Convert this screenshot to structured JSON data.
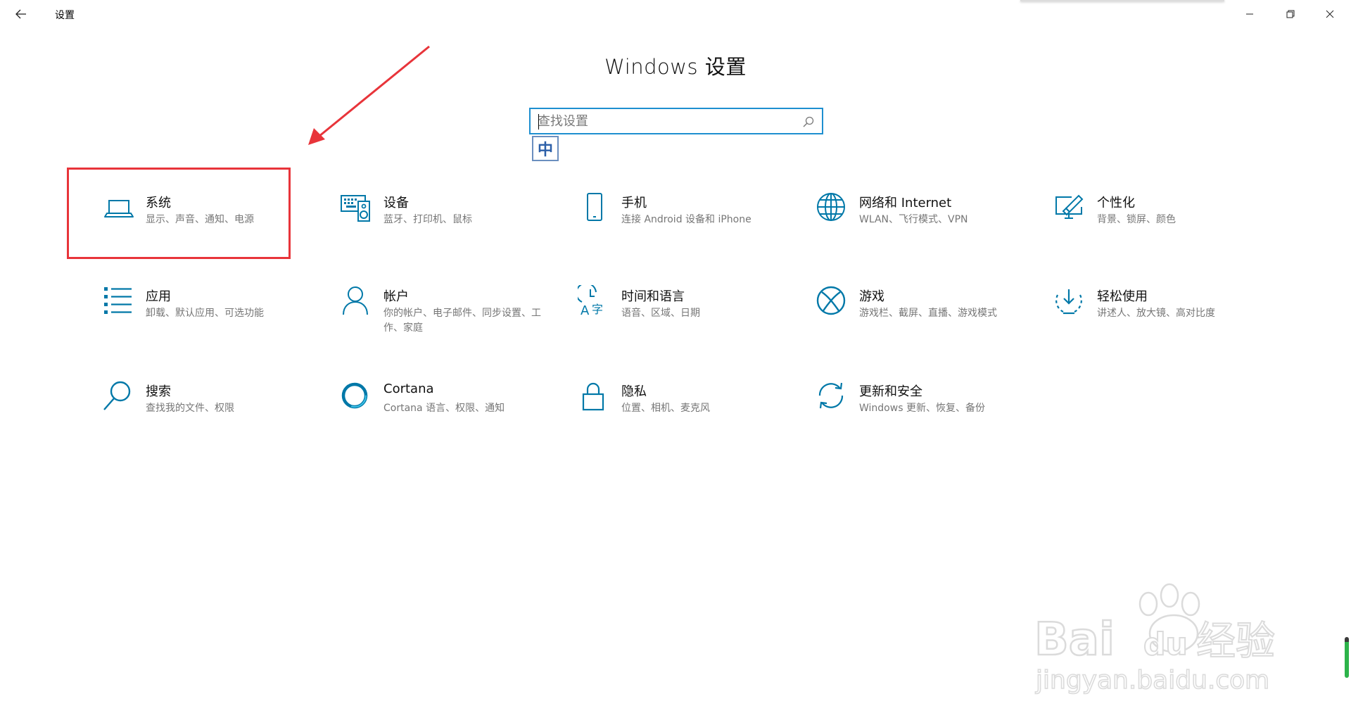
{
  "window": {
    "title": "设置",
    "back_icon": "arrow-left-icon",
    "controls": [
      "minimize-icon",
      "restore-icon",
      "close-icon"
    ]
  },
  "page_title": "Windows 设置",
  "search": {
    "placeholder": "查找设置",
    "value": "",
    "icon": "search-icon"
  },
  "ime_indicator": "中",
  "accent_color": "#0078a8",
  "highlight_color": "#e8343a",
  "tiles": [
    {
      "label": "系统",
      "desc": "显示、声音、通知、电源",
      "icon": "laptop-icon"
    },
    {
      "label": "设备",
      "desc": "蓝牙、打印机、鼠标",
      "icon": "keyboard-speaker-icon"
    },
    {
      "label": "手机",
      "desc": "连接 Android 设备和 iPhone",
      "icon": "phone-icon"
    },
    {
      "label": "网络和 Internet",
      "desc": "WLAN、飞行模式、VPN",
      "icon": "globe-icon"
    },
    {
      "label": "个性化",
      "desc": "背景、锁屏、颜色",
      "icon": "paint-monitor-icon"
    },
    {
      "label": "应用",
      "desc": "卸载、默认应用、可选功能",
      "icon": "app-list-icon"
    },
    {
      "label": "帐户",
      "desc": "你的帐户、电子邮件、同步设置、工作、家庭",
      "icon": "person-icon"
    },
    {
      "label": "时间和语言",
      "desc": "语音、区域、日期",
      "icon": "time-language-icon"
    },
    {
      "label": "游戏",
      "desc": "游戏栏、截屏、直播、游戏模式",
      "icon": "xbox-icon"
    },
    {
      "label": "轻松使用",
      "desc": "讲述人、放大镜、高对比度",
      "icon": "ease-of-access-icon"
    },
    {
      "label": "搜索",
      "desc": "查找我的文件、权限",
      "icon": "magnifier-icon"
    },
    {
      "label": "Cortana",
      "desc": "Cortana 语言、权限、通知",
      "icon": "cortana-ring-icon"
    },
    {
      "label": "隐私",
      "desc": "位置、相机、麦克风",
      "icon": "lock-icon"
    },
    {
      "label": "更新和安全",
      "desc": "Windows 更新、恢复、备份",
      "icon": "sync-arrows-icon"
    }
  ],
  "watermark": {
    "brand": "Bai du 经验",
    "url": "jingyan.baidu.com"
  }
}
